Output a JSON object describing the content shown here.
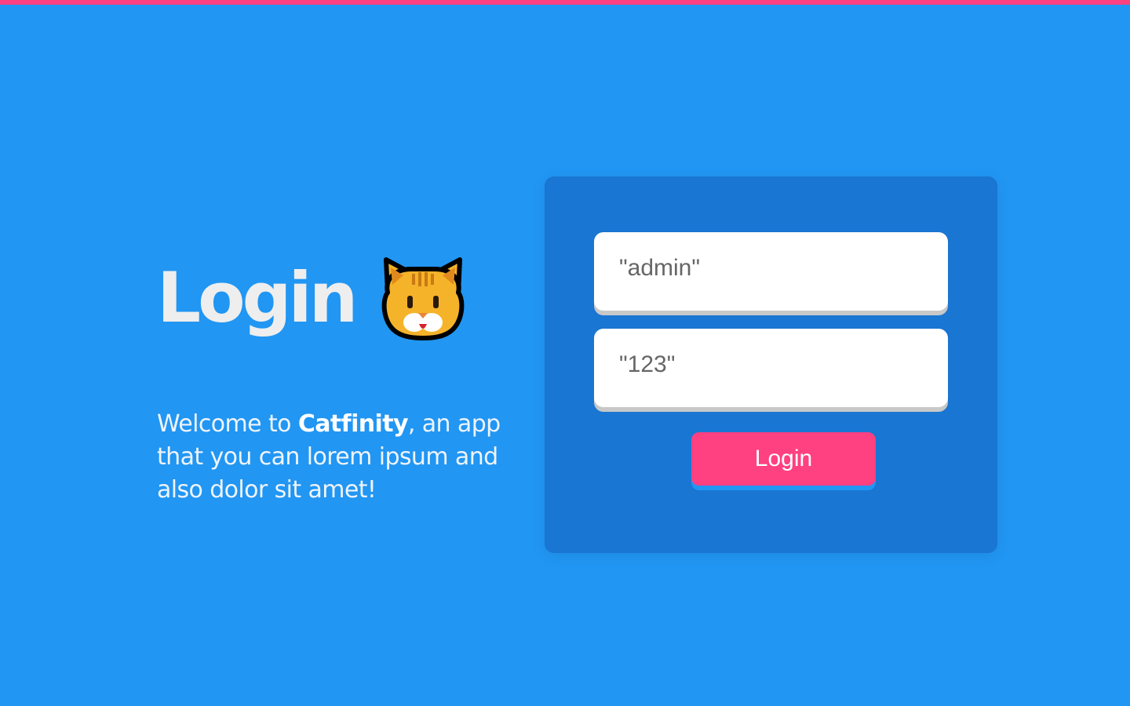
{
  "colors": {
    "background": "#2196f3",
    "top_bar": "#ff4081",
    "card": "#1976d2",
    "button": "#ff4081"
  },
  "header": {
    "title": "Login",
    "title_icon": "cat-face-icon"
  },
  "welcome": {
    "prefix": "Welcome to ",
    "app_name": "Catfinity",
    "suffix": ", an app that you can lorem ipsum and also dolor sit amet!"
  },
  "form": {
    "username_placeholder": "\"admin\"",
    "password_placeholder": "\"123\"",
    "login_label": "Login"
  }
}
